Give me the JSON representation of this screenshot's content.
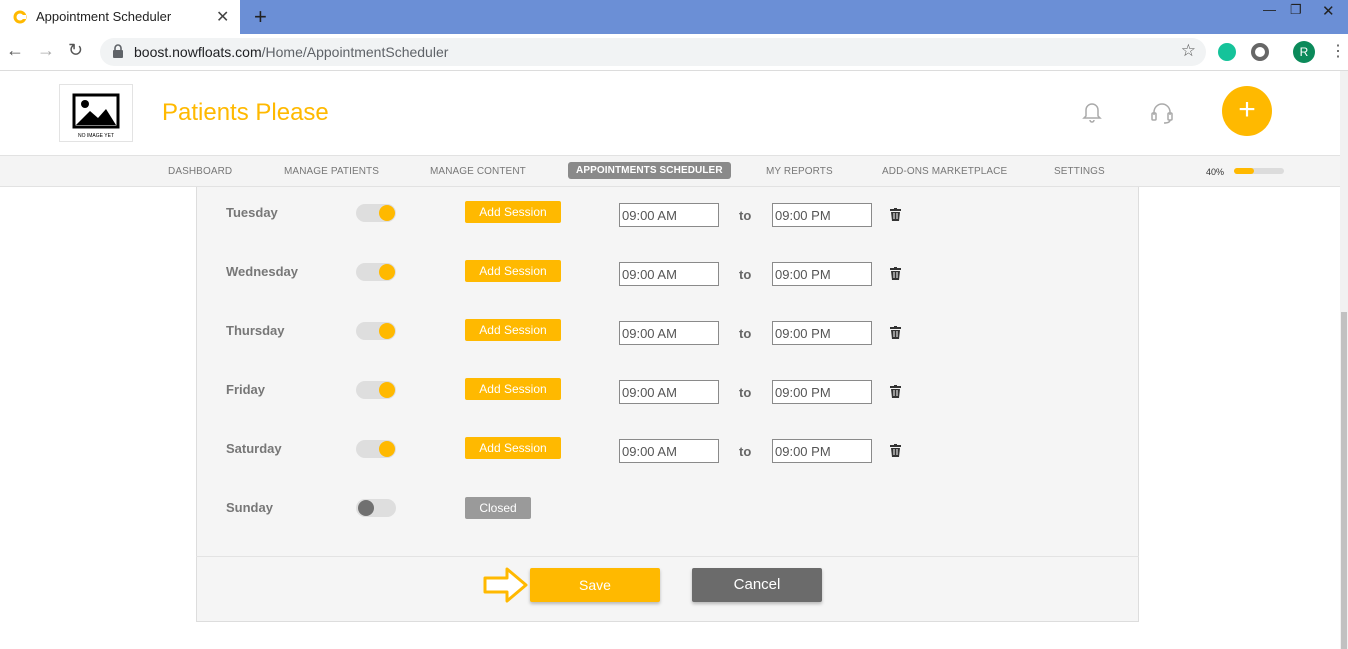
{
  "browser": {
    "tab_title": "Appointment Scheduler",
    "url_host": "boost.nowfloats.com",
    "url_path": "/Home/AppointmentScheduler",
    "profile_initial": "R"
  },
  "header": {
    "logo_caption": "NO IMAGE YET",
    "brand": "Patients Please"
  },
  "nav": {
    "items": [
      {
        "label": "DASHBOARD"
      },
      {
        "label": "MANAGE PATIENTS"
      },
      {
        "label": "MANAGE CONTENT"
      },
      {
        "label": "APPOINTMENTS SCHEDULER"
      },
      {
        "label": "MY REPORTS"
      },
      {
        "label": "ADD-ONS MARKETPLACE"
      },
      {
        "label": "SETTINGS"
      }
    ],
    "active_index": 3,
    "progress_label": "40%",
    "progress_value": 0.4
  },
  "schedule": {
    "add_session_label": "Add Session",
    "closed_label": "Closed",
    "to_label": "to",
    "days": [
      {
        "name": "Tuesday",
        "enabled": true,
        "start": "09:00 AM",
        "end": "09:00 PM"
      },
      {
        "name": "Wednesday",
        "enabled": true,
        "start": "09:00 AM",
        "end": "09:00 PM"
      },
      {
        "name": "Thursday",
        "enabled": true,
        "start": "09:00 AM",
        "end": "09:00 PM"
      },
      {
        "name": "Friday",
        "enabled": true,
        "start": "09:00 AM",
        "end": "09:00 PM"
      },
      {
        "name": "Saturday",
        "enabled": true,
        "start": "09:00 AM",
        "end": "09:00 PM"
      },
      {
        "name": "Sunday",
        "enabled": false,
        "start": "",
        "end": ""
      }
    ]
  },
  "footer": {
    "save_label": "Save",
    "cancel_label": "Cancel"
  },
  "colors": {
    "accent": "#ffb900",
    "titlebar": "#6b8fd6",
    "cancel": "#6b6b6b"
  }
}
